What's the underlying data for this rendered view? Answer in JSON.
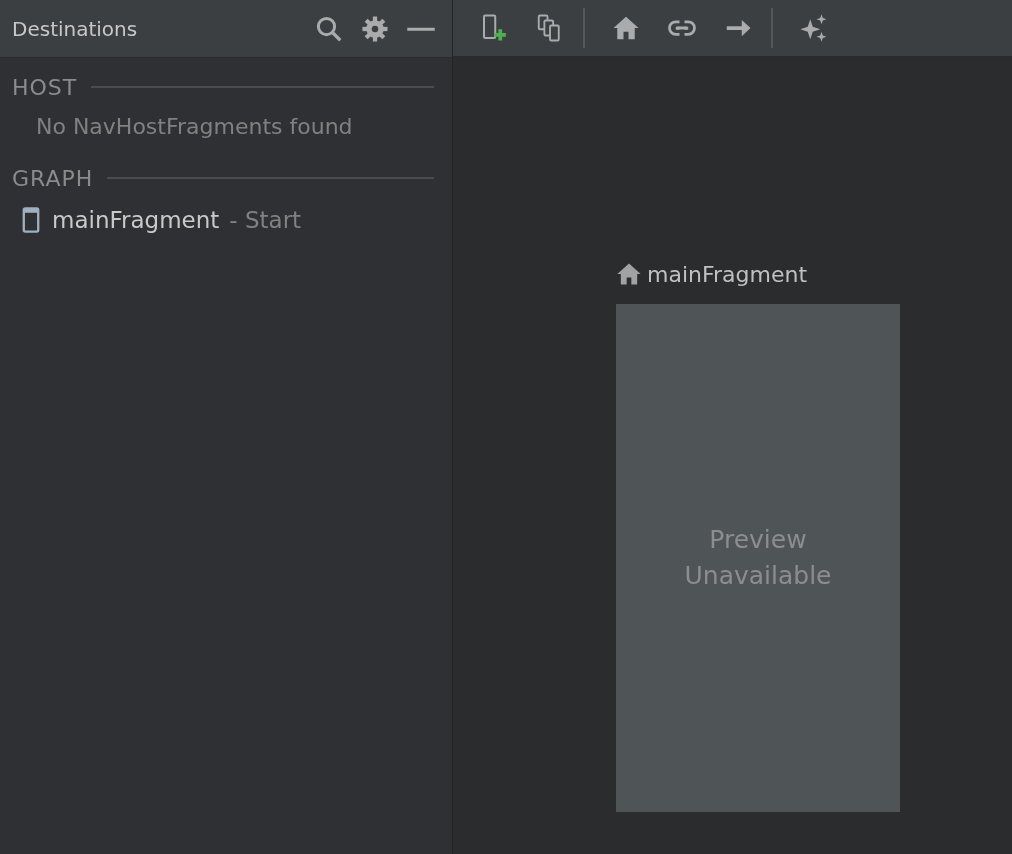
{
  "panel": {
    "title": "Destinations"
  },
  "sections": [
    {
      "label": "HOST",
      "empty_message": "No NavHostFragments found"
    },
    {
      "label": "GRAPH",
      "items": [
        {
          "name": "mainFragment",
          "suffix": "- Start"
        }
      ]
    }
  ],
  "canvas": {
    "nodes": [
      {
        "name": "mainFragment",
        "start": true,
        "preview": "Preview Unavailable"
      }
    ]
  }
}
